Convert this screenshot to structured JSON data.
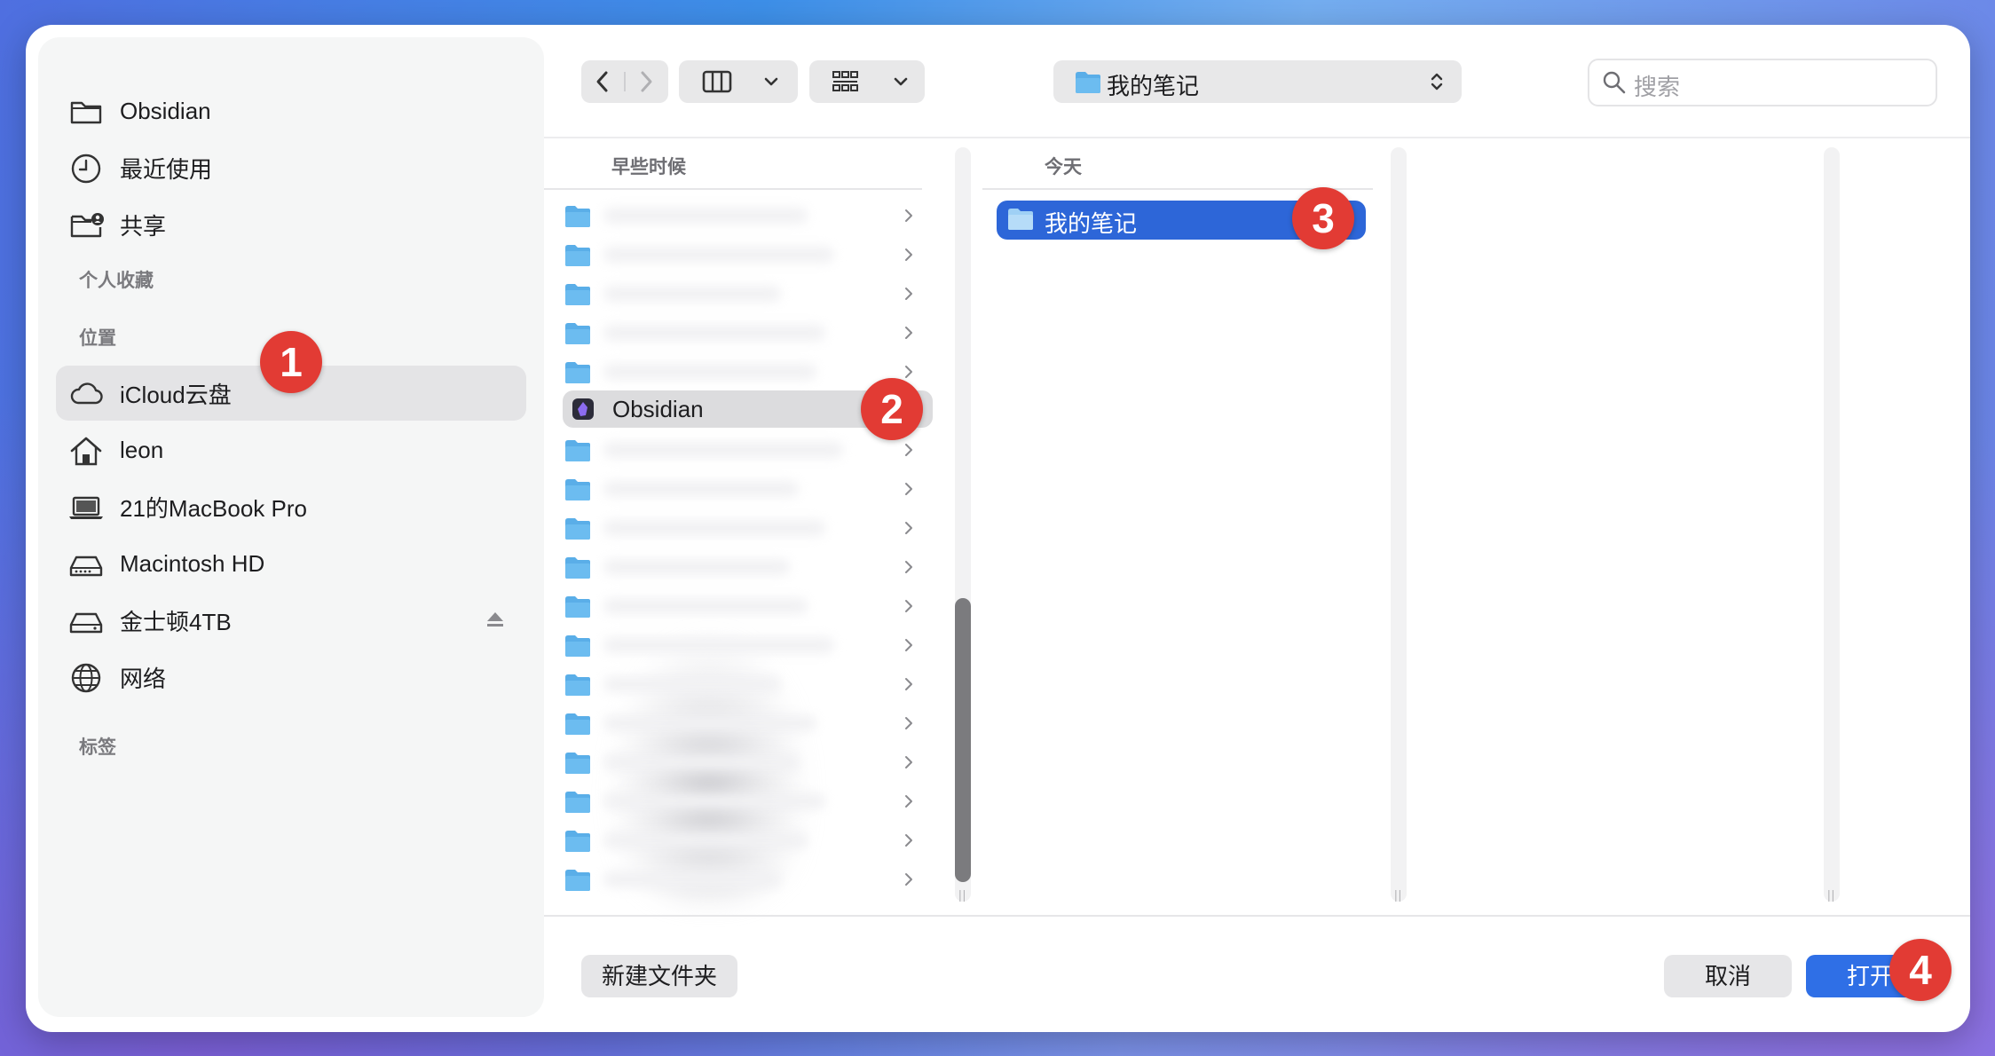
{
  "sidebar": {
    "items_top": [
      {
        "label": "Obsidian",
        "icon": "folder-icon"
      },
      {
        "label": "最近使用",
        "icon": "clock-icon"
      },
      {
        "label": "共享",
        "icon": "shared-folder-icon"
      }
    ],
    "favorites_header": "个人收藏",
    "locations_header": "位置",
    "locations": [
      {
        "label": "iCloud云盘",
        "icon": "cloud-icon"
      },
      {
        "label": "leon",
        "icon": "home-icon"
      },
      {
        "label": "21的MacBook Pro",
        "icon": "laptop-icon"
      },
      {
        "label": "Macintosh HD",
        "icon": "disk-icon"
      },
      {
        "label": "金士顿4TB",
        "icon": "disk-icon"
      },
      {
        "label": "网络",
        "icon": "globe-icon"
      }
    ],
    "tags_header": "标签"
  },
  "toolbar": {
    "path_label": "我的笔记",
    "search_placeholder": "搜索"
  },
  "columns": {
    "col1_header": "早些时候",
    "col1_selected_label": "Obsidian",
    "col2_header": "今天",
    "col2_selected_label": "我的笔记"
  },
  "footer": {
    "new_folder": "新建文件夹",
    "cancel": "取消",
    "open": "打开"
  },
  "badges": [
    "1",
    "2",
    "3",
    "4"
  ],
  "colors": {
    "accent": "#2f6fe6",
    "selection": "#2d66d8",
    "badge": "#e23b34",
    "folder": "#5aaee8"
  }
}
